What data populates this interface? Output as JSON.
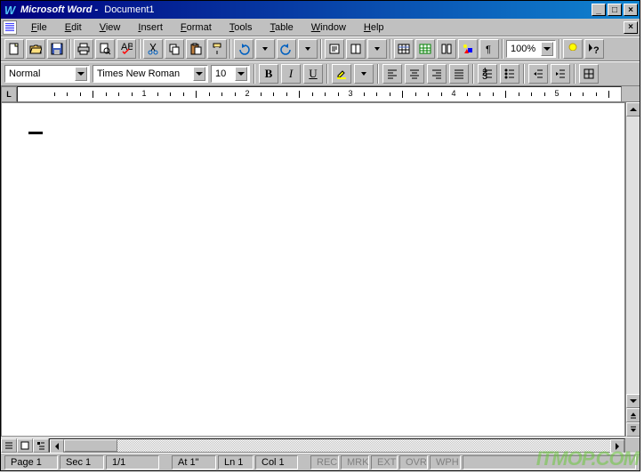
{
  "titlebar": {
    "app": "Microsoft Word",
    "doc": "Document1"
  },
  "menu": {
    "items": [
      "File",
      "Edit",
      "View",
      "Insert",
      "Format",
      "Tools",
      "Table",
      "Window",
      "Help"
    ]
  },
  "toolbar2": {
    "style": "Normal",
    "font": "Times New Roman",
    "size": "10"
  },
  "toolbar1": {
    "zoom": "100%"
  },
  "ruler": {
    "marks": [
      1,
      2,
      3,
      4,
      5
    ]
  },
  "status": {
    "page": "Page  1",
    "sec": "Sec 1",
    "pages": "1/1",
    "at": "At  1\"",
    "ln": "Ln  1",
    "col": "Col  1",
    "modes": [
      "REC",
      "MRK",
      "EXT",
      "OVR",
      "WPH"
    ]
  },
  "watermark": "ITMOP.COM"
}
